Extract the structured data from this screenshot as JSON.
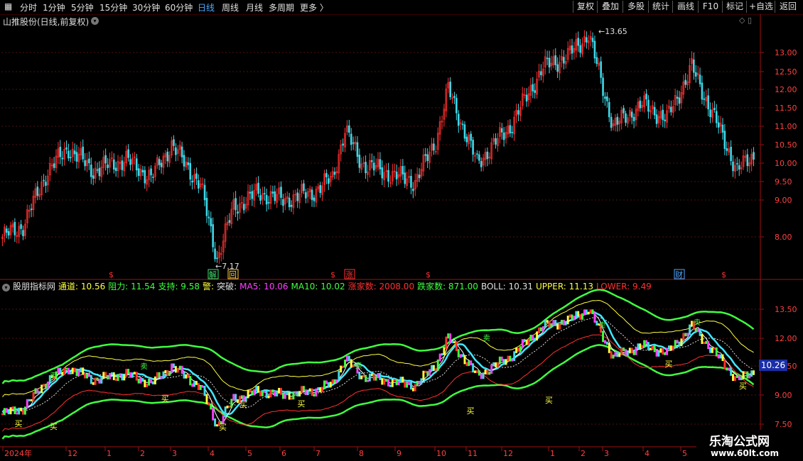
{
  "toolbar": {
    "periods": [
      "分时",
      "1分钟",
      "5分钟",
      "15分钟",
      "30分钟",
      "60分钟",
      "日线",
      "周线",
      "月线",
      "多周期",
      "更多 〉"
    ],
    "active_period": "日线",
    "buttons": [
      "复权",
      "叠加",
      "多股",
      "统计",
      "画线",
      "F10",
      "标记",
      "+自选",
      "返回"
    ]
  },
  "main_chart": {
    "title": "山推股份(日线,前复权)",
    "right_icons": "◇ ▯",
    "y_ticks": [
      "13.00",
      "12.50",
      "12.00",
      "11.50",
      "11.00",
      "10.50",
      "10.00",
      "9.50",
      "9.00",
      "8.00"
    ],
    "high_label": "13.65",
    "low_label": "7.17",
    "markers": [
      {
        "label": "$",
        "color": "#ff3030"
      },
      {
        "label": "解",
        "color": "#40e070"
      },
      {
        "label": "回",
        "color": "#ffd040"
      },
      {
        "label": "$",
        "color": "#ff3030"
      },
      {
        "label": "涨",
        "color": "#ff3030"
      },
      {
        "label": "$",
        "color": "#ff3030"
      },
      {
        "label": "财",
        "color": "#4ea8ff"
      },
      {
        "label": "$",
        "color": "#ff3030"
      }
    ]
  },
  "indicator": {
    "name": "股朋指标网",
    "items": [
      {
        "label": "通道: 10.56",
        "color": "#ffff40"
      },
      {
        "label": "阻力: 11.54",
        "color": "#40ff40"
      },
      {
        "label": "支持: 9.58",
        "color": "#40ff40"
      },
      {
        "label": "警:",
        "color": "#ffff40"
      },
      {
        "label": "突破:",
        "color": "#e0e0e0"
      },
      {
        "label": "MA5: 10.06",
        "color": "#ff40ff"
      },
      {
        "label": "MA10: 10.02",
        "color": "#40ff40"
      },
      {
        "label": "涨家数: 2008.00",
        "color": "#ff3030"
      },
      {
        "label": "跌家数: 871.00",
        "color": "#40ff40"
      },
      {
        "label": "BOLL: 10.31",
        "color": "#e0e0e0"
      },
      {
        "label": "UPPER: 11.13",
        "color": "#ffff40"
      },
      {
        "label": "LOWER: 9.49",
        "color": "#ff3030"
      }
    ],
    "y_ticks": [
      "13.50",
      "12.00",
      "10.50",
      "9.00",
      "7.50"
    ],
    "price_tag": "10.26",
    "buy_label": "买",
    "sell_label": "卖"
  },
  "x_axis": {
    "labels": [
      "2024年",
      "12",
      "1",
      "2",
      "3",
      "4",
      "5",
      "6",
      "7",
      "8",
      "9",
      "10",
      "11",
      "12",
      "1",
      "2",
      "3",
      "4",
      "5"
    ]
  },
  "watermark": {
    "line1": "乐淘公式网",
    "line2": "www.60lt.com"
  }
}
